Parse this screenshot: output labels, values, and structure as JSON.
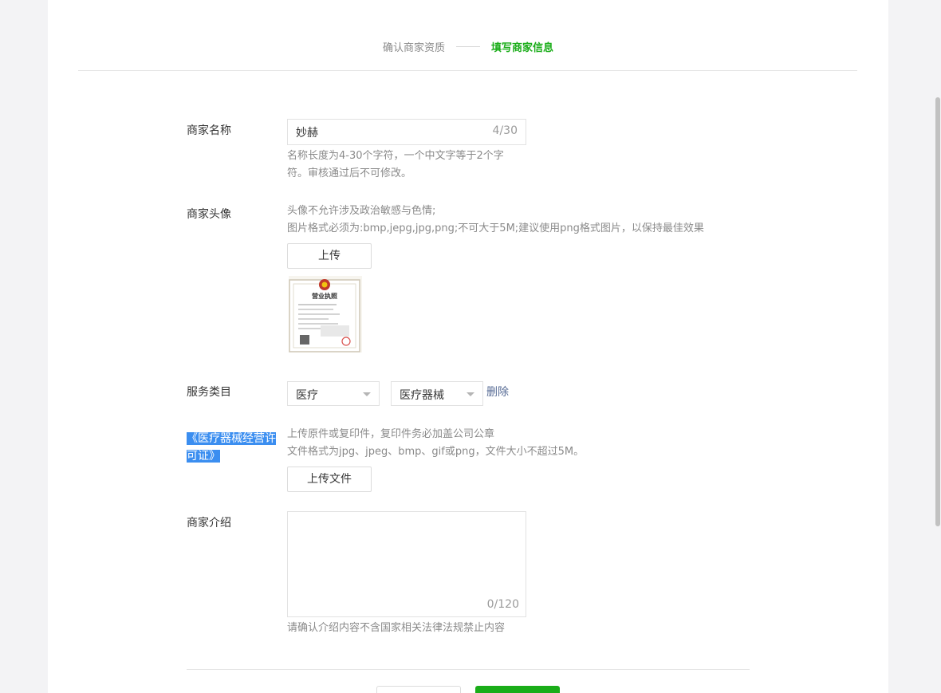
{
  "steps": {
    "step1": "确认商家资质",
    "step2": "填写商家信息"
  },
  "form": {
    "name": {
      "label": "商家名称",
      "value": "妙赫",
      "count": "4/30",
      "tip_line1": "名称长度为4-30个字符，一个中文字等于2个字",
      "tip_line2": "符。审核通过后不可修改。"
    },
    "avatar": {
      "label": "商家头像",
      "tip_line1": "头像不允许涉及政治敏感与色情;",
      "tip_line2": "图片格式必须为:bmp,jepg,jpg,png;不可大于5M;建议使用png格式图片，以保持最佳效果",
      "upload_label": "上传",
      "license_title": "营业执照"
    },
    "category": {
      "label": "服务类目",
      "primary": "医疗",
      "secondary": "医疗器械",
      "delete_label": "删除"
    },
    "permit": {
      "label_line1": "《医疗器械经营许",
      "label_line2": "可证》",
      "tip_line1": "上传原件或复印件，复印件务必加盖公司公章",
      "tip_line2": "文件格式为jpg、jpeg、bmp、gif或png，文件大小不超过5M。",
      "upload_label": "上传文件"
    },
    "intro": {
      "label": "商家介绍",
      "count": "0/120",
      "tip": "请确认介绍内容不含国家相关法律法规禁止内容"
    }
  },
  "colors": {
    "accent": "#1aad19",
    "link": "#576b95",
    "highlight": "#3b8ef0"
  },
  "icons": {
    "select_caret": "caret-down-icon"
  }
}
